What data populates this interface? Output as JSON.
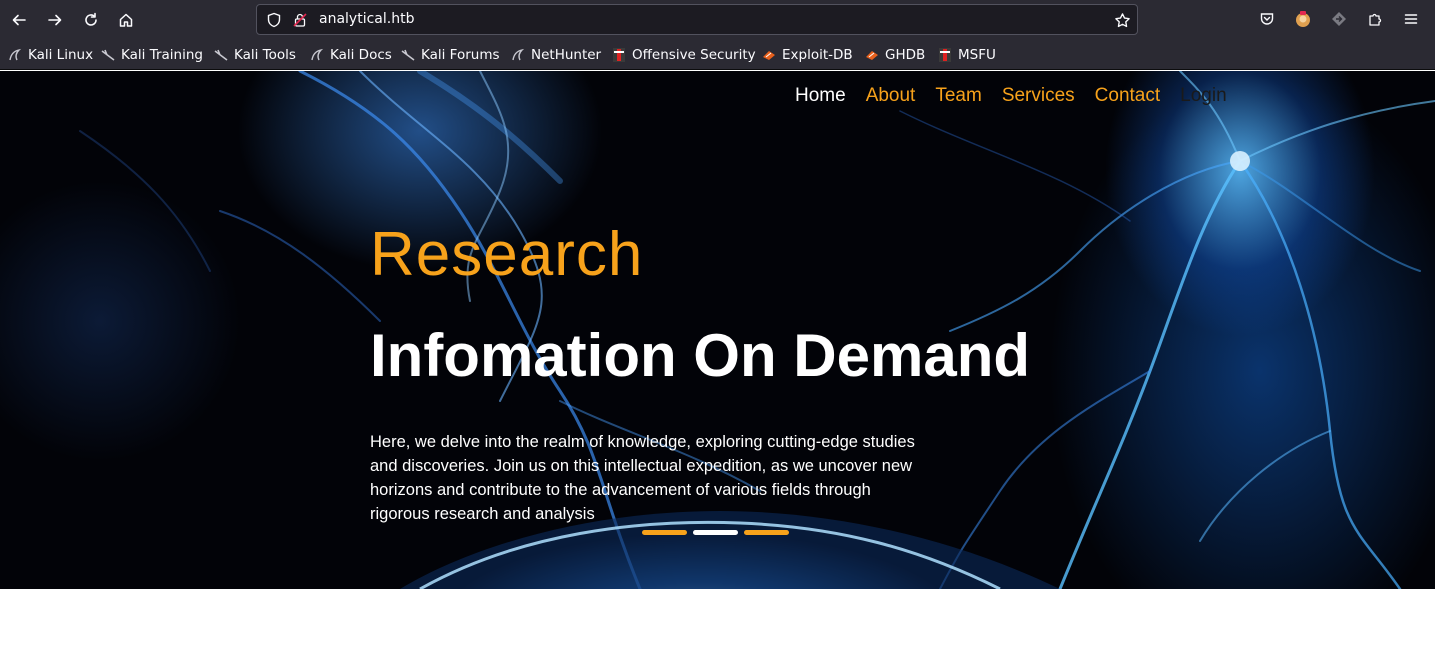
{
  "browser": {
    "url": "analytical.htb",
    "bookmarks": [
      {
        "label": "Kali Linux",
        "icon": "kali-dragon-icon"
      },
      {
        "label": "Kali Training",
        "icon": "kali-dragon-icon"
      },
      {
        "label": "Kali Tools",
        "icon": "kali-dragon-icon"
      },
      {
        "label": "Kali Docs",
        "icon": "kali-dragon-icon"
      },
      {
        "label": "Kali Forums",
        "icon": "kali-dragon-icon"
      },
      {
        "label": "NetHunter",
        "icon": "kali-dragon-icon"
      },
      {
        "label": "Offensive Security",
        "icon": "offsec-icon"
      },
      {
        "label": "Exploit-DB",
        "icon": "exploitdb-icon"
      },
      {
        "label": "GHDB",
        "icon": "exploitdb-icon"
      },
      {
        "label": "MSFU",
        "icon": "offsec-icon"
      }
    ]
  },
  "nav": {
    "home": "Home",
    "about": "About",
    "team": "Team",
    "services": "Services",
    "contact": "Contact",
    "login": "Login"
  },
  "hero": {
    "kicker": "Research",
    "headline": "Infomation On Demand",
    "description": "Here, we delve into the realm of knowledge, exploring cutting-edge studies and discoveries. Join us on this intellectual expedition, as we uncover new horizons and contribute to the advancement of various fields through rigorous research and analysis"
  },
  "carousel": {
    "slides": 3,
    "active_index": 1
  },
  "colors": {
    "accent": "#f7a21b",
    "chrome": "#2b2a33",
    "hero_bg": "#020308"
  }
}
